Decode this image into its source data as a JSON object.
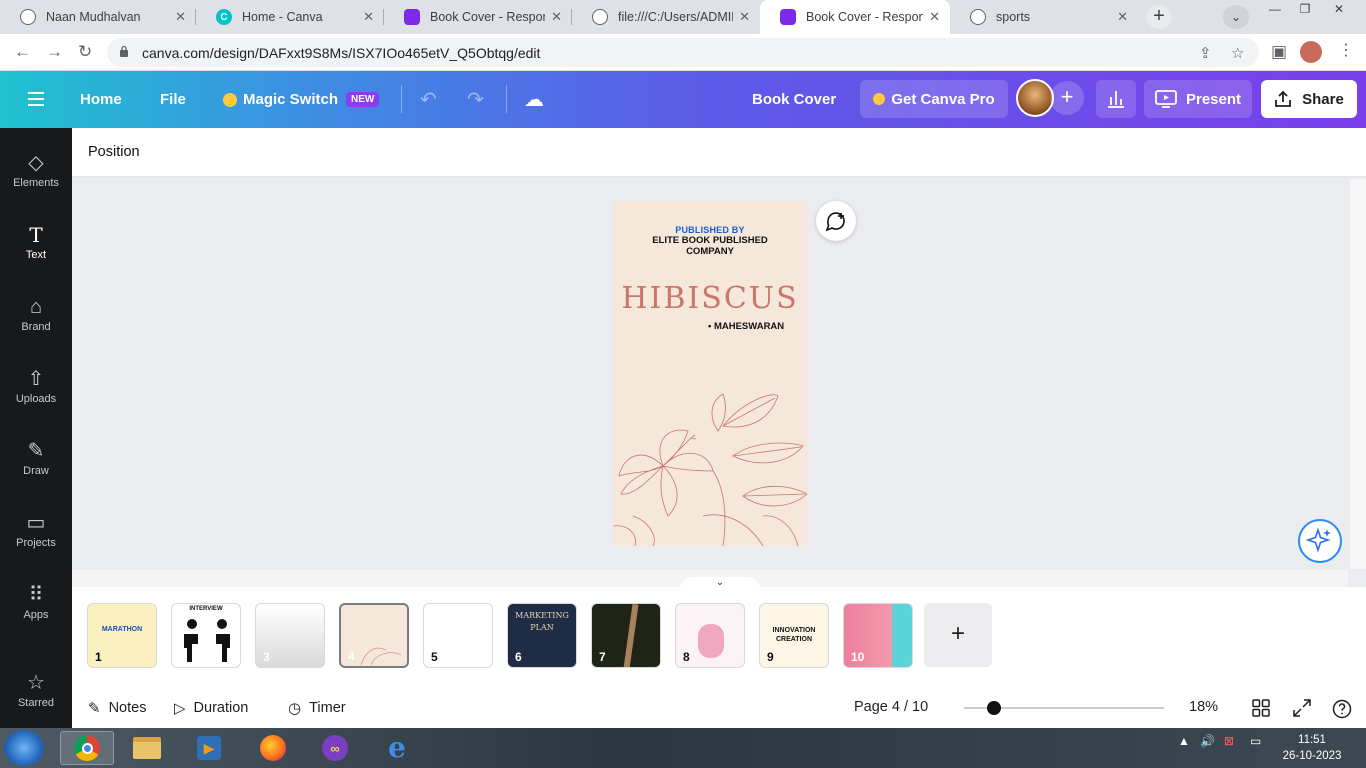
{
  "browser": {
    "tabs": [
      {
        "title": "Naan Mudhalvan",
        "icon": "globe-icon",
        "active": false
      },
      {
        "title": "Home - Canva",
        "icon": "canva-icon",
        "active": false
      },
      {
        "title": "Book Cover - Responsiv",
        "icon": "canva-design-icon",
        "active": false
      },
      {
        "title": "file:///C:/Users/ADMIN/",
        "icon": "globe-icon",
        "active": false
      },
      {
        "title": "Book Cover - Responsiv",
        "icon": "canva-design-icon",
        "active": true
      },
      {
        "title": "sports",
        "icon": "globe-icon",
        "active": false
      }
    ],
    "url": "canva.com/design/DAFxxt9S8Ms/ISX7IOo465etV_Q5Obtqg/edit"
  },
  "canva_header": {
    "home": "Home",
    "file": "File",
    "magic_switch": "Magic Switch",
    "new_badge": "NEW",
    "design_title": "Book Cover",
    "get_pro": "Get Canva Pro",
    "present": "Present",
    "share": "Share"
  },
  "sidebar": {
    "items": [
      {
        "label": "Elements",
        "icon": "elements-icon"
      },
      {
        "label": "Text",
        "icon": "text-icon"
      },
      {
        "label": "Brand",
        "icon": "brand-icon"
      },
      {
        "label": "Uploads",
        "icon": "upload-icon"
      },
      {
        "label": "Draw",
        "icon": "draw-icon"
      },
      {
        "label": "Projects",
        "icon": "folder-icon"
      },
      {
        "label": "Apps",
        "icon": "apps-icon"
      },
      {
        "label": "Starred",
        "icon": "star-icon"
      }
    ]
  },
  "context_toolbar": {
    "position": "Position"
  },
  "design": {
    "published_by": "PUBLISHED BY",
    "company": "ELITE BOOK PUBLISHED COMPANY",
    "title": "HIBISCUS",
    "author": "• MAHESWARAN",
    "title_color": "#c9756a",
    "background": "#f5e8da"
  },
  "pages": [
    {
      "num": "1",
      "label": "MARATHON",
      "color": "#fbf0c0"
    },
    {
      "num": "2",
      "label": "INTERVIEW",
      "color": "#ffffff"
    },
    {
      "num": "3",
      "label": "",
      "color": "#e8e8ea"
    },
    {
      "num": "4",
      "label": "",
      "color": "#f5e8da"
    },
    {
      "num": "5",
      "label": "",
      "color": "#ffffff"
    },
    {
      "num": "6",
      "label": "MARKETING PLAN",
      "color": "#1e2c46"
    },
    {
      "num": "7",
      "label": "",
      "color": "#1e2416"
    },
    {
      "num": "8",
      "label": "",
      "color": "#fbf3f6"
    },
    {
      "num": "9",
      "label": "INNOVATION CREATION",
      "color": "#fdf6e6"
    },
    {
      "num": "10",
      "label": "",
      "color": "#ee7e9b"
    }
  ],
  "footer": {
    "notes": "Notes",
    "duration": "Duration",
    "timer": "Timer",
    "page_indicator": "Page 4 / 10",
    "zoom": "18%"
  },
  "taskbar": {
    "time": "11:51",
    "date": "26-10-2023"
  }
}
